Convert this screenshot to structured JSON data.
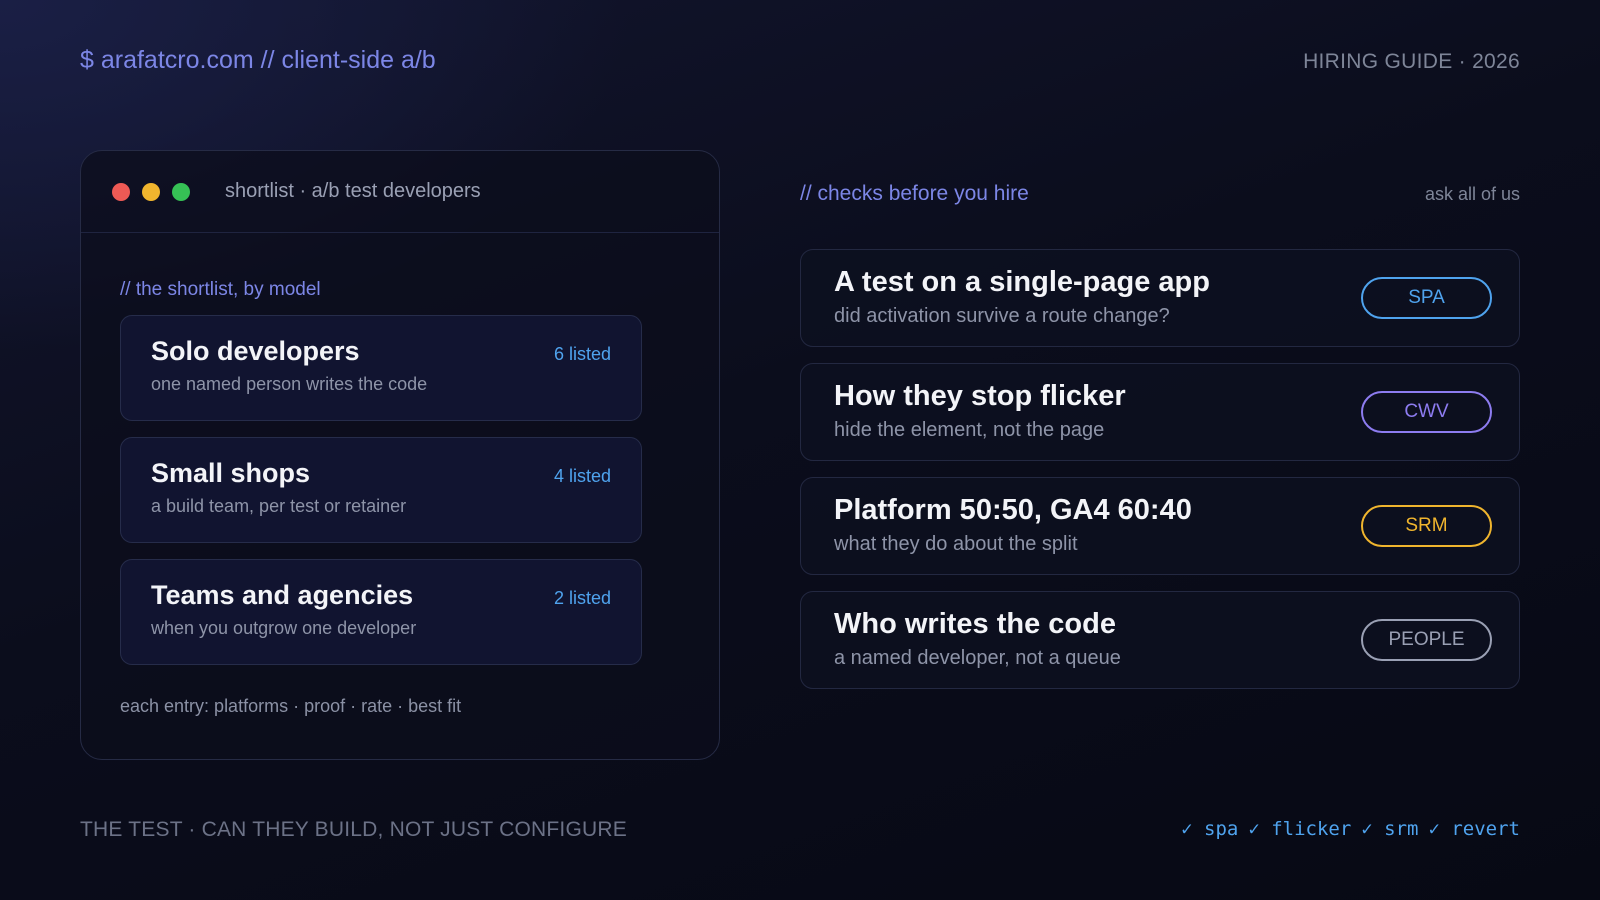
{
  "header": {
    "site": "$ arafatcro.com // client-side a/b",
    "guide": "HIRING GUIDE · 2026"
  },
  "window": {
    "title": "shortlist · a/b test developers",
    "section_label": "// the shortlist, by model",
    "models": [
      {
        "title": "Solo developers",
        "subtitle": "one named person writes the code",
        "count": "6 listed"
      },
      {
        "title": "Small shops",
        "subtitle": "a build team, per test or retainer",
        "count": "4 listed"
      },
      {
        "title": "Teams and agencies",
        "subtitle": "when you outgrow one developer",
        "count": "2 listed"
      }
    ],
    "footer": "each entry: platforms · proof · rate · best fit"
  },
  "checks": {
    "label": "// checks before you hire",
    "aside": "ask all of us",
    "items": [
      {
        "title": "A test on a single-page app",
        "subtitle": "did activation survive a route change?",
        "tag": "SPA",
        "tag_color": "#4fa3ee"
      },
      {
        "title": "How they stop flicker",
        "subtitle": "hide the element, not the page",
        "tag": "CWV",
        "tag_color": "#8d7cf0"
      },
      {
        "title": "Platform 50:50, GA4 60:40",
        "subtitle": "what they do about the split",
        "tag": "SRM",
        "tag_color": "#f0b52e"
      },
      {
        "title": "Who writes the code",
        "subtitle": "a named developer, not a queue",
        "tag": "PEOPLE",
        "tag_color": "#9aa0b4"
      }
    ]
  },
  "footer": {
    "tagline": "THE TEST · CAN THEY BUILD, NOT JUST CONFIGURE",
    "ticks": [
      "✓ spa",
      "✓ flicker",
      "✓ srm",
      "✓ revert"
    ]
  }
}
